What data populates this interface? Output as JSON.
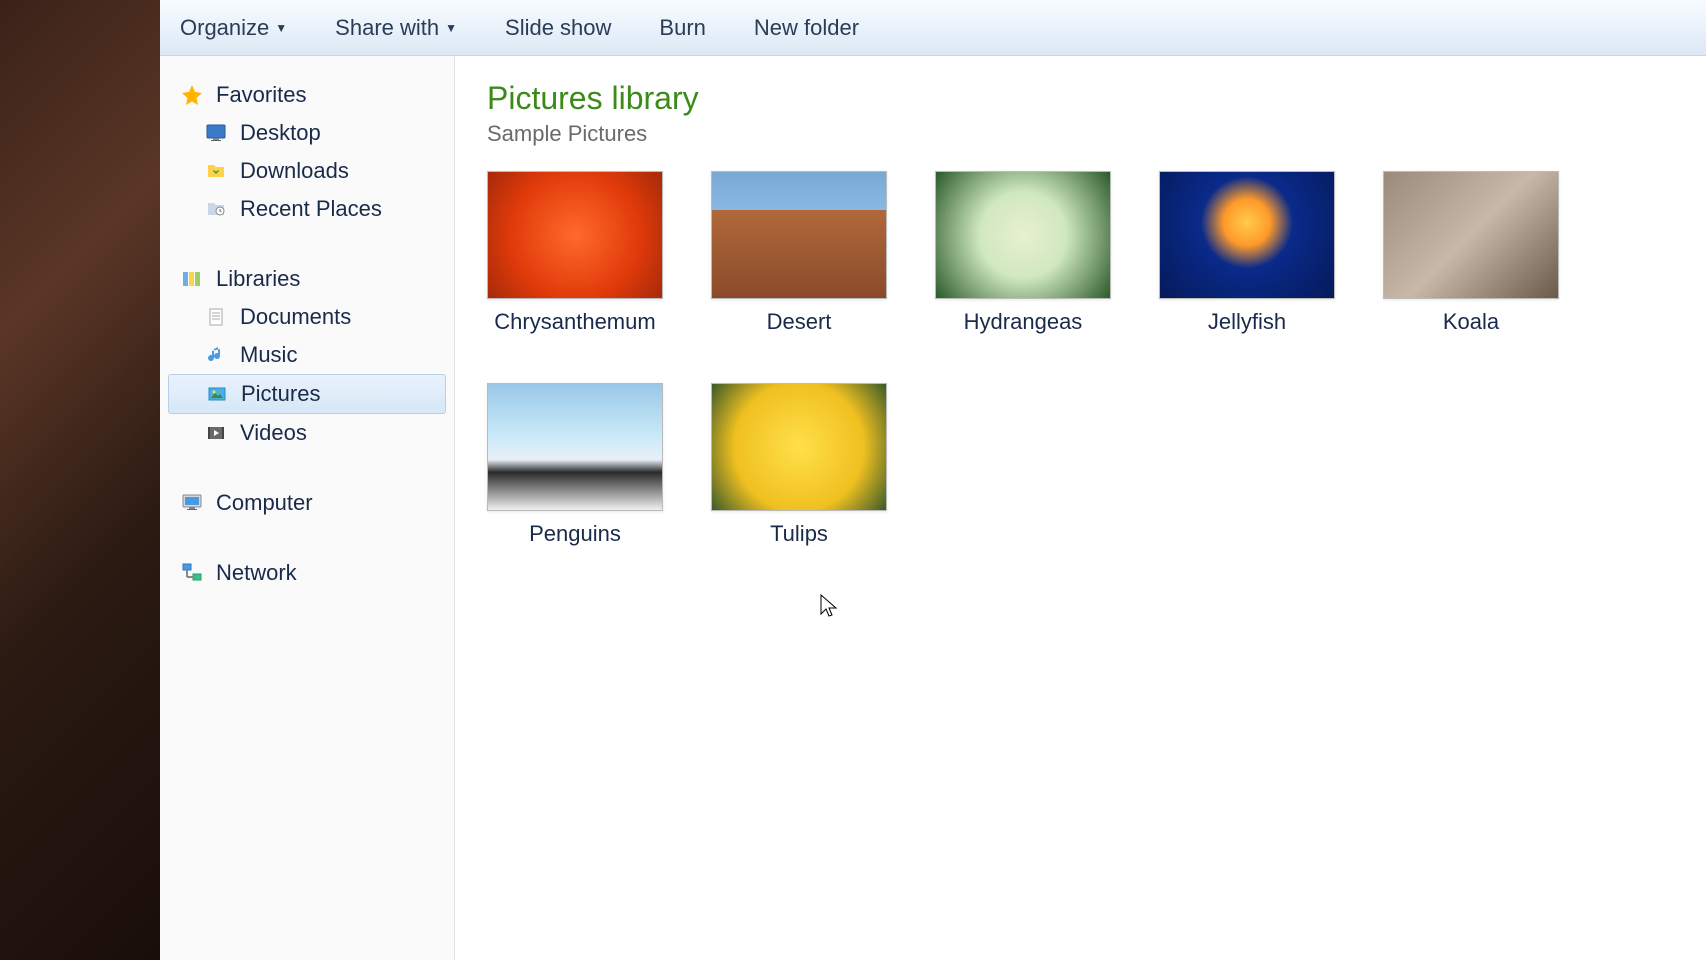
{
  "toolbar": {
    "organize": "Organize",
    "share_with": "Share with",
    "slide_show": "Slide show",
    "burn": "Burn",
    "new_folder": "New folder"
  },
  "sidebar": {
    "favorites": {
      "header": "Favorites",
      "items": [
        {
          "label": "Desktop",
          "icon": "desktop"
        },
        {
          "label": "Downloads",
          "icon": "downloads"
        },
        {
          "label": "Recent Places",
          "icon": "recent"
        }
      ]
    },
    "libraries": {
      "header": "Libraries",
      "items": [
        {
          "label": "Documents",
          "icon": "documents"
        },
        {
          "label": "Music",
          "icon": "music"
        },
        {
          "label": "Pictures",
          "icon": "pictures",
          "selected": true
        },
        {
          "label": "Videos",
          "icon": "videos"
        }
      ]
    },
    "computer": "Computer",
    "network": "Network"
  },
  "content": {
    "title": "Pictures library",
    "subtitle": "Sample Pictures",
    "thumbnails": [
      {
        "label": "Chrysanthemum",
        "class": "thumb-chrysanthemum"
      },
      {
        "label": "Desert",
        "class": "thumb-desert"
      },
      {
        "label": "Hydrangeas",
        "class": "thumb-hydrangeas"
      },
      {
        "label": "Jellyfish",
        "class": "thumb-jellyfish"
      },
      {
        "label": "Koala",
        "class": "thumb-koala"
      },
      {
        "label": "Penguins",
        "class": "thumb-penguins"
      },
      {
        "label": "Tulips",
        "class": "thumb-tulips"
      }
    ]
  }
}
